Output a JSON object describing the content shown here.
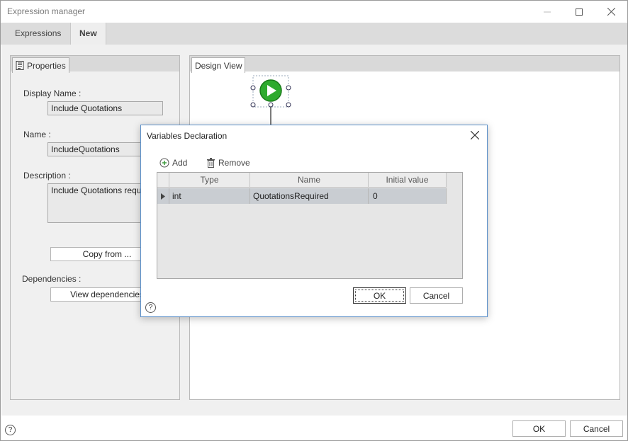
{
  "window": {
    "title": "Expression manager"
  },
  "tabs": [
    {
      "label": "Expressions"
    },
    {
      "label": "New"
    }
  ],
  "properties": {
    "tab_label": "Properties",
    "display_name_label": "Display Name :",
    "display_name_value": "Include Quotations",
    "name_label": "Name :",
    "name_value": "IncludeQuotations",
    "description_label": "Description :",
    "description_value": "Include Quotations requir",
    "copy_from_label": "Copy from ...",
    "dependencies_label": "Dependencies :",
    "view_dependencies_label": "View dependencies"
  },
  "design_view": {
    "tab_label": "Design View"
  },
  "dialog": {
    "title": "Variables Declaration",
    "add_label": "Add",
    "remove_label": "Remove",
    "columns": [
      "Type",
      "Name",
      "Initial value"
    ],
    "rows": [
      {
        "type": "int",
        "name": "QuotationsRequired",
        "initial": "0"
      }
    ],
    "ok_label": "OK",
    "cancel_label": "Cancel",
    "help_glyph": "?"
  },
  "footer": {
    "ok_label": "OK",
    "cancel_label": "Cancel",
    "help_glyph": "?"
  },
  "colors": {
    "start_node": "#2eaa2e",
    "dialog_border": "#5a8fc9",
    "selected_row": "#c9cdd2"
  }
}
